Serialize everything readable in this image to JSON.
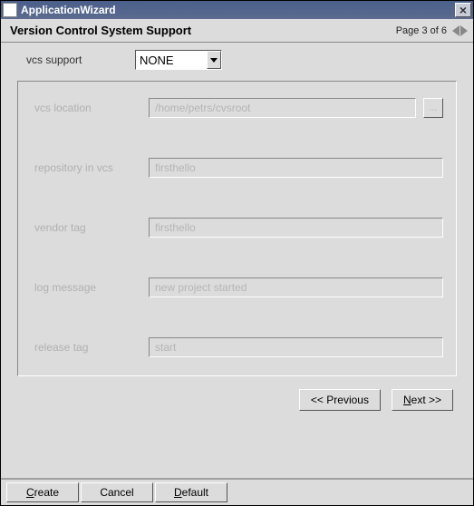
{
  "titlebar": {
    "title": "ApplicationWizard",
    "close_glyph": "×"
  },
  "header": {
    "title": "Version Control System Support",
    "page_label": "Page 3 of 6"
  },
  "vcs_support": {
    "label": "vcs support",
    "selected": "NONE"
  },
  "fields": {
    "vcs_location": {
      "label": "vcs location",
      "value": "/home/petrs/cvsroot",
      "browse": "..."
    },
    "repository_in_vcs": {
      "label": "repository in vcs",
      "value": "firsthello"
    },
    "vendor_tag": {
      "label": "vendor tag",
      "value": "firsthello"
    },
    "log_message": {
      "label": "log message",
      "value": "new project started"
    },
    "release_tag": {
      "label": "release tag",
      "value": "start"
    }
  },
  "nav": {
    "previous": "<< Previous",
    "next_prefix": "N",
    "next_rest": "ext >>"
  },
  "footer": {
    "create_prefix": "C",
    "create_rest": "reate",
    "cancel": "Cancel",
    "default_prefix": "D",
    "default_rest": "efault"
  }
}
